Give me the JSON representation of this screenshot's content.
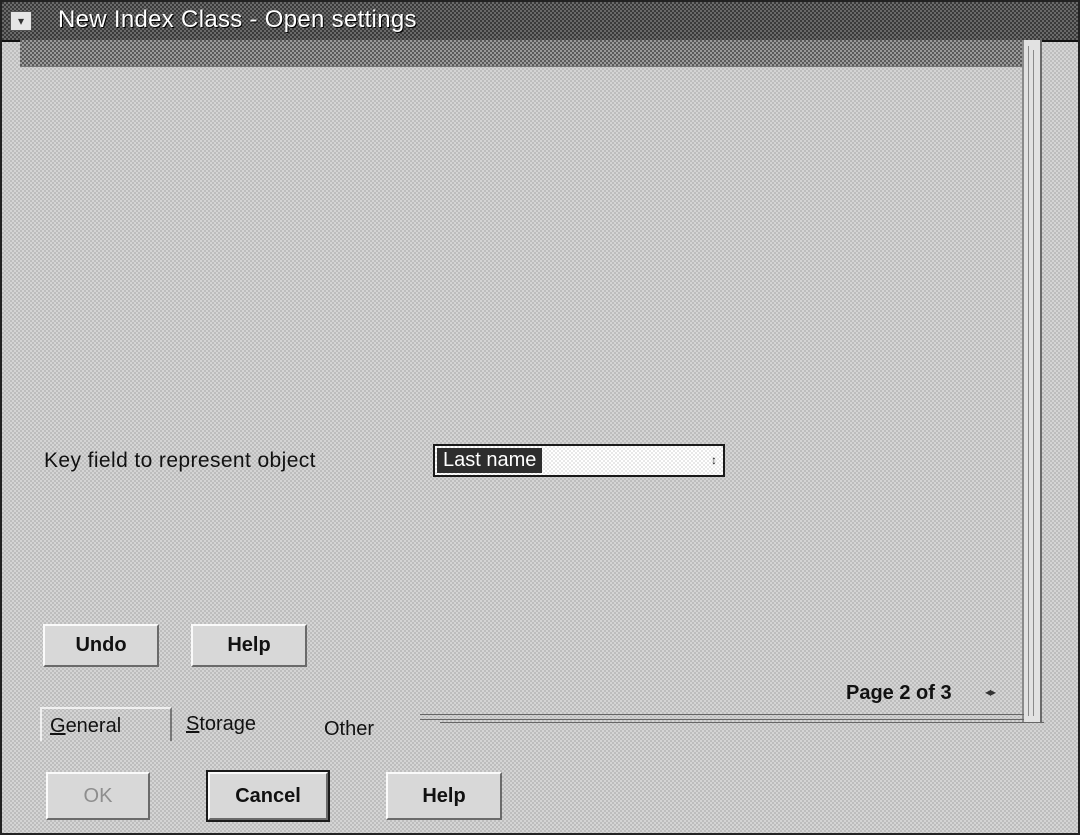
{
  "window": {
    "title": "New Index Class - Open settings",
    "system_menu_glyph": "▾"
  },
  "form": {
    "key_field_label": "Key field to represent object",
    "key_field_value": "Last name",
    "dropdown_arrow_glyph": "↕"
  },
  "page_buttons": {
    "undo_label": "Undo",
    "help_label": "Help"
  },
  "pagination": {
    "page_text": "Page 2 of 3",
    "arrows_glyph": "◂▸"
  },
  "tabs": [
    {
      "mnemonic": "G",
      "rest": "eneral",
      "active": true
    },
    {
      "mnemonic": "S",
      "rest": "torage",
      "active": false
    },
    {
      "mnemonic": "",
      "rest": "Other",
      "active": false
    }
  ],
  "dialog_buttons": {
    "ok_label": "OK",
    "cancel_label": "Cancel",
    "help_label": "Help"
  }
}
